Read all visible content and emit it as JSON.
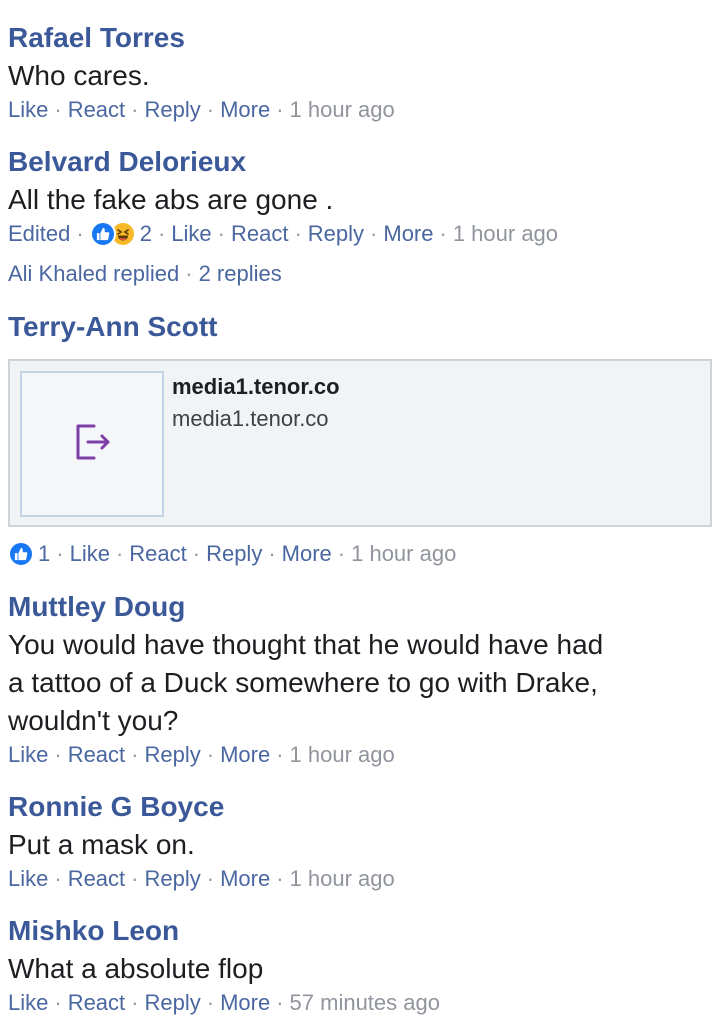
{
  "action_labels": {
    "like": "Like",
    "react": "React",
    "reply": "Reply",
    "more": "More",
    "edited": "Edited",
    "separator": "·"
  },
  "comments": [
    {
      "author": "Rafael Torres",
      "text": "Who cares.",
      "time": "1 hour ago"
    },
    {
      "author": "Belvard Delorieux",
      "text": "All the fake abs are gone .",
      "reaction_count": "2",
      "time": "1 hour ago",
      "replies_summary": "Ali Khaled replied",
      "replies_count": "2 replies",
      "reaction_icons": [
        "like-reaction-icon",
        "haha-reaction-icon"
      ]
    },
    {
      "author": "Terry-Ann Scott",
      "link_title": "media1.tenor.co",
      "link_domain": "media1.tenor.co",
      "link_icon": "external-link-icon",
      "reaction_count": "1",
      "time": "1 hour ago",
      "reaction_icons": [
        "like-reaction-icon"
      ]
    },
    {
      "author": "Muttley Doug",
      "text_lines": [
        "You would have thought that he would have had",
        "a tattoo of a Duck somewhere to go with Drake,",
        "wouldn't you?"
      ],
      "time": "1 hour ago"
    },
    {
      "author": "Ronnie G Boyce",
      "text": "Put a mask on.",
      "time": "1 hour ago"
    },
    {
      "author": "Mishko Leon",
      "text": "What a absolute flop",
      "time": "57 minutes ago"
    }
  ],
  "colors": {
    "author": "#3b5998",
    "link": "#4b67a1",
    "muted": "#90949c",
    "like_blue": "#1877f2",
    "haha_yellow": "#f7b928",
    "link_icon_purple": "#7b3fa8"
  }
}
